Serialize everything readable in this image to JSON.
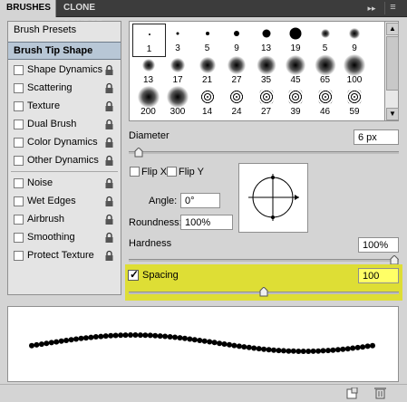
{
  "tabs": {
    "brushes": "BRUSHES",
    "clone_source": "CLONE SOURCE",
    "collapse_icon": "▸▸",
    "menu_icon": "≡"
  },
  "sidebar": {
    "presets": "Brush Presets",
    "tip_shape": "Brush Tip Shape",
    "items": [
      {
        "label": "Shape Dynamics",
        "lock": true
      },
      {
        "label": "Scattering",
        "lock": true
      },
      {
        "label": "Texture",
        "lock": true
      },
      {
        "label": "Dual Brush",
        "lock": true
      },
      {
        "label": "Color Dynamics",
        "lock": true
      },
      {
        "label": "Other Dynamics",
        "lock": true
      },
      {
        "label": "Noise",
        "lock": true
      },
      {
        "label": "Wet Edges",
        "lock": true
      },
      {
        "label": "Airbrush",
        "lock": true
      },
      {
        "label": "Smoothing",
        "lock": true
      },
      {
        "label": "Protect Texture",
        "lock": true
      }
    ]
  },
  "brushes": [
    {
      "size": "1",
      "kind": "hard",
      "d": 2
    },
    {
      "size": "3",
      "kind": "hard",
      "d": 3
    },
    {
      "size": "5",
      "kind": "hard",
      "d": 4
    },
    {
      "size": "9",
      "kind": "hard",
      "d": 6
    },
    {
      "size": "13",
      "kind": "hard",
      "d": 9
    },
    {
      "size": "19",
      "kind": "hard",
      "d": 13
    },
    {
      "size": "5",
      "kind": "soft",
      "d": 4
    },
    {
      "size": "9",
      "kind": "soft",
      "d": 6
    },
    {
      "size": "13",
      "kind": "soft",
      "d": 8
    },
    {
      "size": "17",
      "kind": "soft",
      "d": 10
    },
    {
      "size": "21",
      "kind": "soft",
      "d": 12
    },
    {
      "size": "27",
      "kind": "soft",
      "d": 14
    },
    {
      "size": "35",
      "kind": "soft",
      "d": 15
    },
    {
      "size": "45",
      "kind": "soft",
      "d": 16
    },
    {
      "size": "65",
      "kind": "soft",
      "d": 17
    },
    {
      "size": "100",
      "kind": "soft",
      "d": 18
    },
    {
      "size": "200",
      "kind": "soft",
      "d": 18
    },
    {
      "size": "300",
      "kind": "soft",
      "d": 18
    },
    {
      "size": "14",
      "kind": "spatter",
      "d": 14
    },
    {
      "size": "24",
      "kind": "spatter",
      "d": 15
    },
    {
      "size": "27",
      "kind": "spatter",
      "d": 16
    },
    {
      "size": "39",
      "kind": "spatter",
      "d": 16
    },
    {
      "size": "46",
      "kind": "spatter",
      "d": 16
    },
    {
      "size": "59",
      "kind": "spatter",
      "d": 16
    },
    {
      "size": "",
      "kind": "spatter",
      "d": 14
    },
    {
      "size": "",
      "kind": "spatter",
      "d": 14
    },
    {
      "size": "",
      "kind": "spatter",
      "d": 14
    },
    {
      "size": "",
      "kind": "spatter",
      "d": 14
    },
    {
      "size": "",
      "kind": "spatter",
      "d": 14
    },
    {
      "size": "",
      "kind": "spatter",
      "d": 14
    },
    {
      "size": "",
      "kind": "spatter",
      "d": 14
    },
    {
      "size": "",
      "kind": "spatter",
      "d": 14
    }
  ],
  "controls": {
    "diameter_label": "Diameter",
    "diameter_value": "6 px",
    "diameter_level": 0.02,
    "flip_x": "Flip X",
    "flip_y": "Flip Y",
    "angle_label": "Angle:",
    "angle_value": "0°",
    "roundness_label": "Roundness:",
    "roundness_value": "100%",
    "hardness_label": "Hardness",
    "hardness_value": "100%",
    "hardness_level": 1.0,
    "spacing_label": "Spacing",
    "spacing_value": "100",
    "spacing_level": 0.5,
    "spacing_checked": true
  },
  "colors": {
    "highlight": "#dede35",
    "selected_bg": "#b8c7d6"
  },
  "icons": {
    "lock": "lock-icon",
    "new": "new-preset-icon",
    "trash": "trash-icon"
  }
}
